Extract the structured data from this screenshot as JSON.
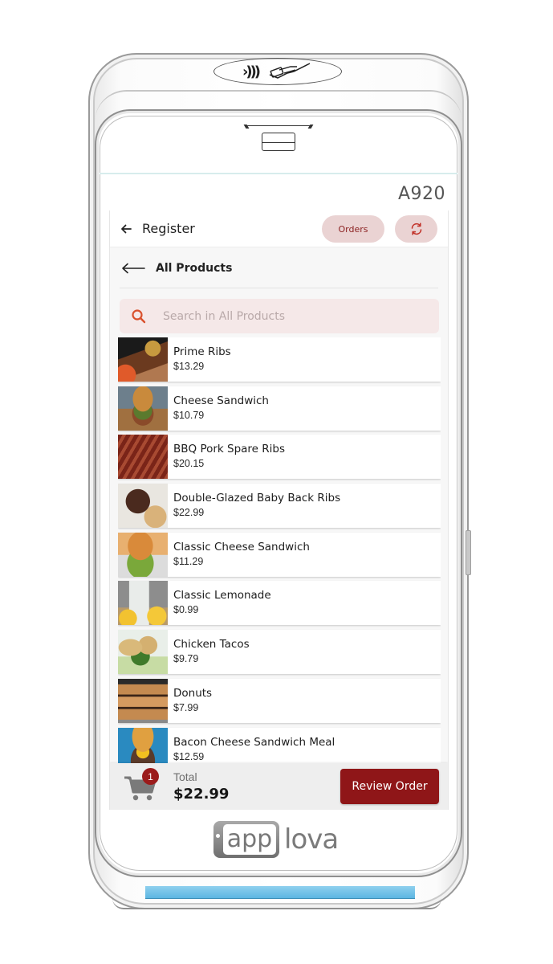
{
  "device": {
    "model": "A920",
    "nfc_icon": "contactless-icon",
    "tap_icon": "tap-card-icon",
    "brand": {
      "part1": "app",
      "part2": "lova"
    }
  },
  "topbar": {
    "back_icon": "arrow-left-icon",
    "title": "Register",
    "orders_label": "Orders",
    "refresh_icon": "refresh-icon"
  },
  "subheader": {
    "back_icon": "long-arrow-left-icon",
    "title": "All Products"
  },
  "search": {
    "icon": "search-icon",
    "placeholder": "Search in All Products",
    "value": ""
  },
  "products": [
    {
      "name": "Prime Ribs",
      "price": "$13.29",
      "image": "ribs-photo"
    },
    {
      "name": "Cheese Sandwich",
      "price": "$10.79",
      "image": "burger-photo"
    },
    {
      "name": "BBQ Pork Spare Ribs",
      "price": "$20.15",
      "image": "ribs-photo"
    },
    {
      "name": "Double-Glazed Baby Back Ribs",
      "price": "$22.99",
      "image": "ribs-photo"
    },
    {
      "name": "Classic Cheese Sandwich",
      "price": "$11.29",
      "image": "burger-photo"
    },
    {
      "name": "Classic Lemonade",
      "price": "$0.99",
      "image": "lemonade-photo"
    },
    {
      "name": "Chicken Tacos",
      "price": "$9.79",
      "image": "tacos-photo"
    },
    {
      "name": "Donuts",
      "price": "$7.99",
      "image": "donuts-photo"
    },
    {
      "name": "Bacon Cheese Sandwich Meal",
      "price": "$12.59",
      "image": "burger-photo"
    }
  ],
  "footer": {
    "cart_icon": "cart-icon",
    "cart_count": "1",
    "total_label": "Total",
    "total_value": "$22.99",
    "review_label": "Review Order"
  },
  "colors": {
    "accent": "#8f1618",
    "pill_bg": "#ead3d3",
    "search_bg": "#f5e8e8",
    "search_icon": "#d9502c",
    "status_light": "#5cb6e2"
  }
}
